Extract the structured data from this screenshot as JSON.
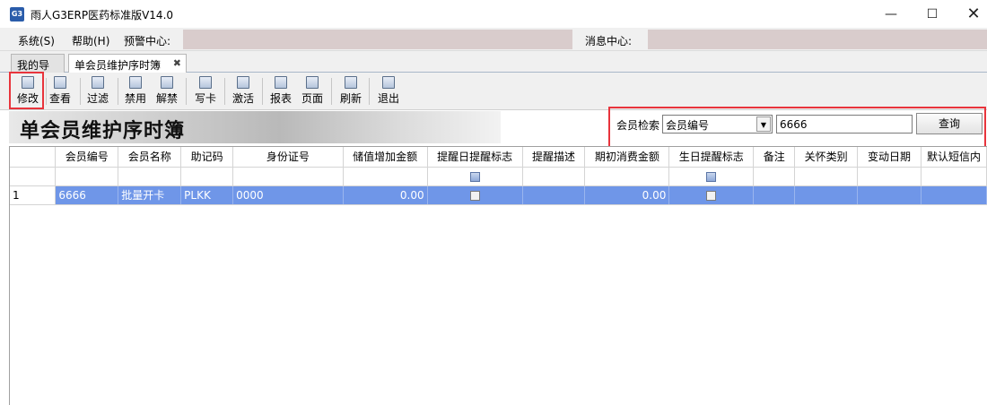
{
  "window": {
    "title": "雨人G3ERP医药标准版V14.0",
    "app_icon": "G3"
  },
  "menubar": {
    "system": "系统(S)",
    "help": "帮助(H)",
    "alert_center": "预警中心:",
    "message_center": "消息中心:"
  },
  "tabs": [
    {
      "label": "我的导航"
    },
    {
      "label": "单会员维护序时簿"
    }
  ],
  "toolbar": [
    {
      "label": "修改",
      "icon": "edit-icon"
    },
    {
      "label": "查看",
      "icon": "view-icon"
    },
    {
      "label": "过滤",
      "icon": "filter-icon"
    },
    {
      "label": "禁用",
      "icon": "disable-icon"
    },
    {
      "label": "解禁",
      "icon": "enable-icon"
    },
    {
      "label": "写卡",
      "icon": "write-card-icon"
    },
    {
      "label": "激活",
      "icon": "activate-icon"
    },
    {
      "label": "报表",
      "icon": "report-icon"
    },
    {
      "label": "页面",
      "icon": "page-icon"
    },
    {
      "label": "刷新",
      "icon": "refresh-icon"
    },
    {
      "label": "退出",
      "icon": "exit-icon"
    }
  ],
  "banner": {
    "title": "单会员维护序时簿"
  },
  "search": {
    "label": "会员检索",
    "field_selected": "会员编号",
    "value": "6666",
    "button": "查询"
  },
  "grid": {
    "columns": [
      "会员编号",
      "会员名称",
      "助记码",
      "身份证号",
      "储值增加金额",
      "提醒日提醒标志",
      "提醒描述",
      "期初消费金额",
      "生日提醒标志",
      "备注",
      "关怀类别",
      "变动日期",
      "默认短信内"
    ],
    "rows": [
      {
        "row_num": "1",
        "member_no": "6666",
        "member_name": "批量开卡",
        "mnemonic": "PLKK",
        "id_card": "0000",
        "stored_add": "0.00",
        "reminder_flag": false,
        "reminder_desc": "",
        "initial_spend": "0.00",
        "birthday_flag": false,
        "remark": "",
        "care_type": "",
        "change_date": "",
        "default_sms": ""
      }
    ]
  },
  "colors": {
    "highlight_red": "#e8343c",
    "selected_row": "#6f96e8",
    "info_box": "#d9cccc"
  }
}
